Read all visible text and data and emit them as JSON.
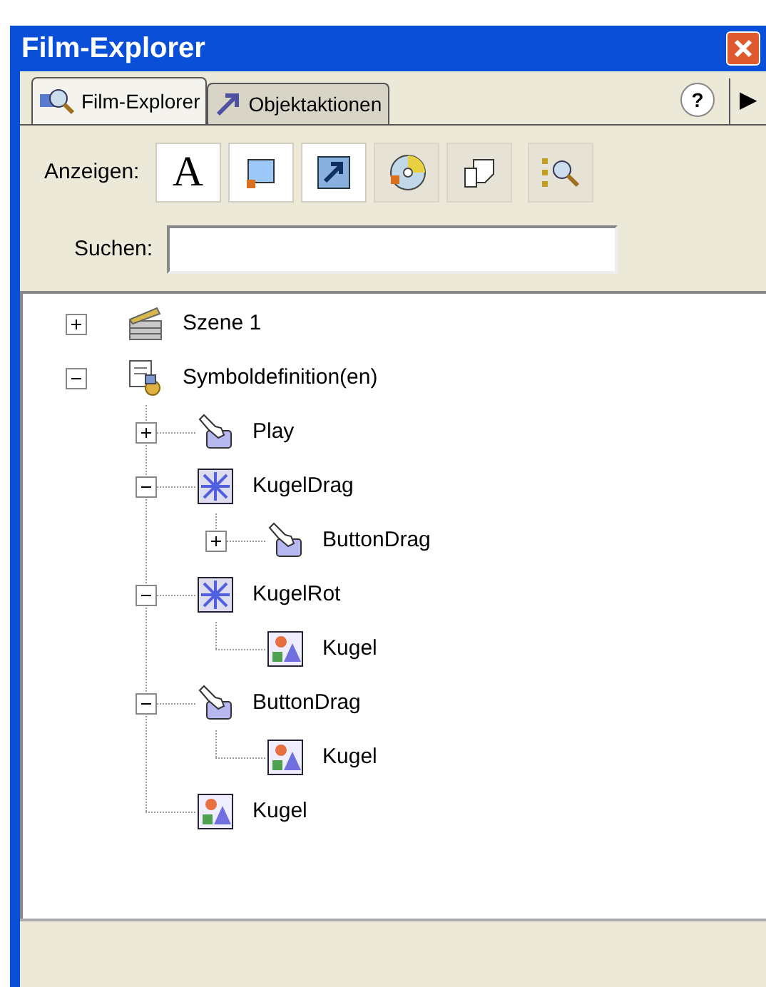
{
  "window": {
    "title": "Film-Explorer"
  },
  "tabs": [
    {
      "label": "Film-Explorer",
      "selected": true,
      "kind": "explorer"
    },
    {
      "label": "Objektaktionen",
      "selected": false,
      "kind": "actions"
    }
  ],
  "help": "?",
  "menu_arrow": "▶",
  "show": {
    "label": "Anzeigen:",
    "tools": [
      {
        "kind": "text",
        "label": "A",
        "selected": true
      },
      {
        "kind": "shape",
        "selected": true
      },
      {
        "kind": "action",
        "selected": true
      },
      {
        "kind": "media",
        "selected": false
      },
      {
        "kind": "frames",
        "selected": false
      },
      {
        "kind": "custom",
        "selected": false
      }
    ]
  },
  "search": {
    "label": "Suchen:"
  },
  "tree": [
    {
      "label": "Szene 1",
      "kind": "scene",
      "expanded": false
    },
    {
      "label": "Symboldefinition(en)",
      "kind": "symbols",
      "expanded": true,
      "children": [
        {
          "label": "Play",
          "kind": "button",
          "expanded": false
        },
        {
          "label": "KugelDrag",
          "kind": "movieclip",
          "expanded": true,
          "children": [
            {
              "label": "ButtonDrag",
              "kind": "button",
              "expanded": false
            }
          ]
        },
        {
          "label": "KugelRot",
          "kind": "movieclip",
          "expanded": true,
          "children": [
            {
              "label": "Kugel",
              "kind": "graphic"
            }
          ]
        },
        {
          "label": "ButtonDrag",
          "kind": "button",
          "expanded": true,
          "children": [
            {
              "label": "Kugel",
              "kind": "graphic"
            }
          ]
        },
        {
          "label": "Kugel",
          "kind": "graphic"
        }
      ]
    }
  ]
}
